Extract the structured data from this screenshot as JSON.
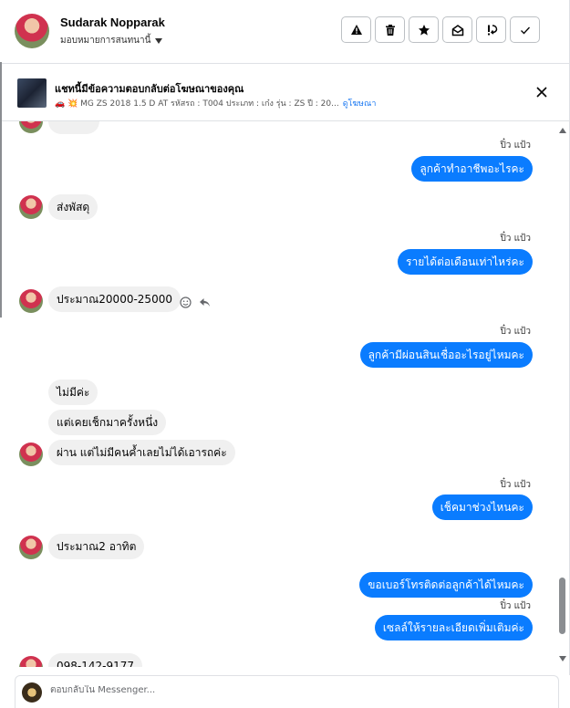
{
  "header": {
    "name": "Sudarak Nopparak",
    "assign_label": "มอบหมายการสนทนานี้",
    "toolbar": [
      {
        "icon": "alert-icon"
      },
      {
        "icon": "trash-icon"
      },
      {
        "icon": "star-icon"
      },
      {
        "icon": "mark-unread-icon"
      },
      {
        "icon": "follow-up-icon"
      },
      {
        "icon": "check-icon"
      }
    ]
  },
  "ad": {
    "title": "แชทนี้มีข้อความตอบกลับต่อโฆษณาของคุณ",
    "subtitle": "🚗 💥 MG ZS 2018 1.5 D AT รหัสรถ : T004 ประเภท : เก๋ง รุ่น : ZS ปี : 20...",
    "link": "ดูโฆษณา"
  },
  "messages": {
    "s1": "ปิ๋ว แป้ว",
    "o1": "ลูกค้าทำอาชีพอะไรคะ",
    "i1": "ส่งพัสดุ",
    "s2": "ปิ๋ว แป้ว",
    "o2": "รายได้ต่อเดือนเท่าไหร่คะ",
    "i2": "ประมาณ20000-25000",
    "s3": "ปิ๋ว แป้ว",
    "o3": "ลูกค้ามีผ่อนสินเชื่ออะไรอยู่ไหมคะ",
    "i3a": "ไม่มีค่ะ",
    "i3b": "แต่เคยเช็กมาครั้งหนึ่ง",
    "i3c": "ผ่าน แต่ไม่มีคนค้ำเลยไม่ได้เอารถค่ะ",
    "s4": "ปิ๋ว แป้ว",
    "o4": "เช็คมาช่วงไหนคะ",
    "i4": "ประมาณ2 อาทิต",
    "o5": "ขอเบอร์โทรติดต่อลูกค้าได้ไหมคะ",
    "s5": "ปิ๋ว แป้ว",
    "o6": "เซลล์ให้รายละเอียดเพิ่มเติมค่ะ",
    "i5": "098-142-9177"
  },
  "composer": {
    "placeholder": "ตอบกลับใน Messenger..."
  },
  "colors": {
    "outgoing_bubble": "#0a7cff",
    "incoming_bubble": "#f0f0f0",
    "link": "#1877f2"
  }
}
